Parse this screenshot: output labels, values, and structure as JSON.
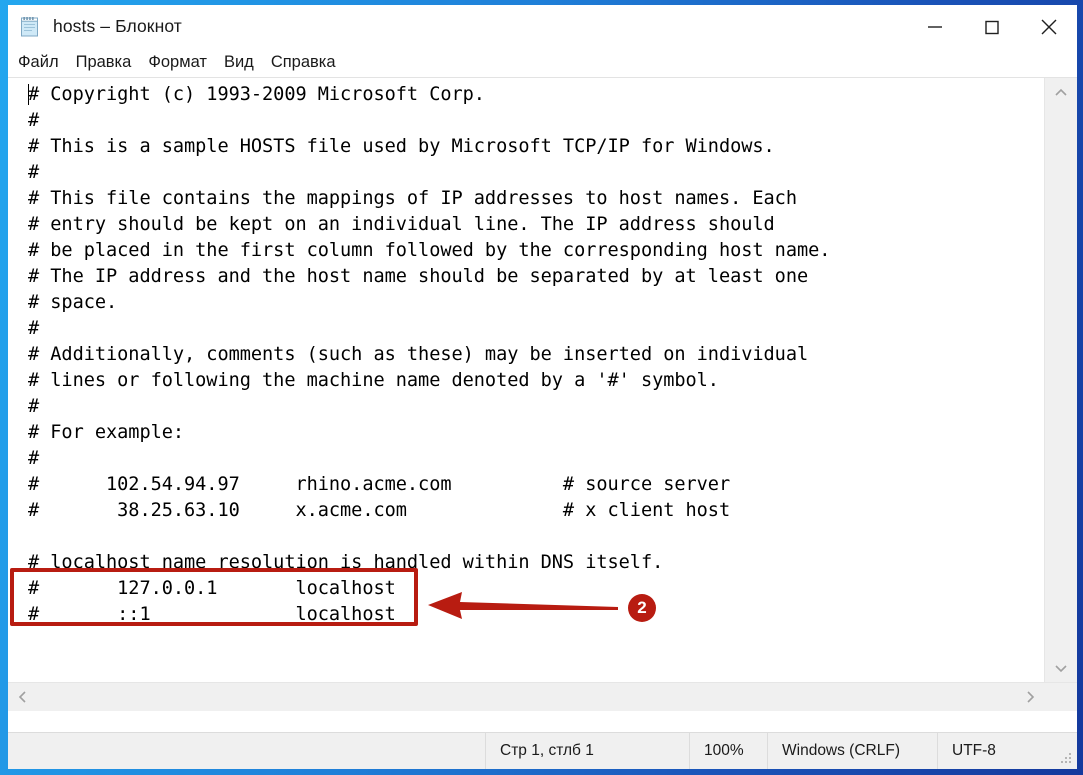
{
  "window": {
    "title": "hosts – Блокнот",
    "icon": "notepad-icon",
    "controls": {
      "minimize": "minimize-icon",
      "maximize": "maximize-icon",
      "close": "close-icon"
    },
    "border_color": "#1f7fd8"
  },
  "menu": {
    "items": [
      {
        "label": "Файл"
      },
      {
        "label": "Правка"
      },
      {
        "label": "Формат"
      },
      {
        "label": "Вид"
      },
      {
        "label": "Справка"
      }
    ]
  },
  "editor": {
    "lines": [
      "# Copyright (c) 1993-2009 Microsoft Corp.",
      "#",
      "# This is a sample HOSTS file used by Microsoft TCP/IP for Windows.",
      "#",
      "# This file contains the mappings of IP addresses to host names. Each",
      "# entry should be kept on an individual line. The IP address should",
      "# be placed in the first column followed by the corresponding host name.",
      "# The IP address and the host name should be separated by at least one",
      "# space.",
      "#",
      "# Additionally, comments (such as these) may be inserted on individual",
      "# lines or following the machine name denoted by a '#' symbol.",
      "#",
      "# For example:",
      "#",
      "#      102.54.94.97     rhino.acme.com          # source server",
      "#       38.25.63.10     x.acme.com              # x client host",
      "",
      "# localhost name resolution is handled within DNS itself.",
      "#\t127.0.0.1       localhost",
      "#\t::1             localhost"
    ],
    "caret_visible": true
  },
  "scrollbars": {
    "vertical": {
      "up_icon": "chevron-up-icon",
      "down_icon": "chevron-down-icon"
    },
    "horizontal": {
      "left_icon": "chevron-left-icon",
      "right_icon": "chevron-right-icon"
    }
  },
  "status_bar": {
    "position": "Стр 1, стлб 1",
    "zoom": "100%",
    "line_ending": "Windows (CRLF)",
    "encoding": "UTF-8",
    "grip": "resize-grip-icon"
  },
  "annotation": {
    "step_number": "2",
    "color": "#B81C11",
    "highlight_target": "localhost entries",
    "arrow_direction": "left"
  }
}
